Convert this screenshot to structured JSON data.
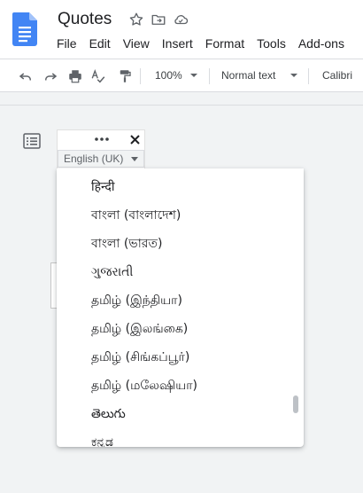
{
  "doc": {
    "title": "Quotes"
  },
  "menu": [
    "File",
    "Edit",
    "View",
    "Insert",
    "Format",
    "Tools",
    "Add-ons"
  ],
  "toolbar": {
    "zoom": "100%",
    "style": "Normal text",
    "font": "Calibri"
  },
  "language_widget": {
    "selected": "English (UK)"
  },
  "languages": [
    "हिन्दी",
    "বাংলা (বাংলাদেশ)",
    "বাংলা (ভারত)",
    "ગુજરાતી",
    "தமிழ் (இந்தியா)",
    "தமிழ் (இலங்கை)",
    "தமிழ் (சிங்கப்பூர்)",
    "தமிழ் (மலேஷியா)",
    "తెలుగు",
    "ಕನ್ನಡ"
  ],
  "icons": [
    "docs-logo-icon",
    "star-icon",
    "move-folder-icon",
    "cloud-status-icon",
    "undo-icon",
    "redo-icon",
    "print-icon",
    "spellcheck-icon",
    "paint-format-icon",
    "outline-icon",
    "more-options-icon",
    "close-icon"
  ],
  "colors": {
    "brand": "#4285f4",
    "canvas": "#f1f3f4",
    "text": "#202124"
  }
}
